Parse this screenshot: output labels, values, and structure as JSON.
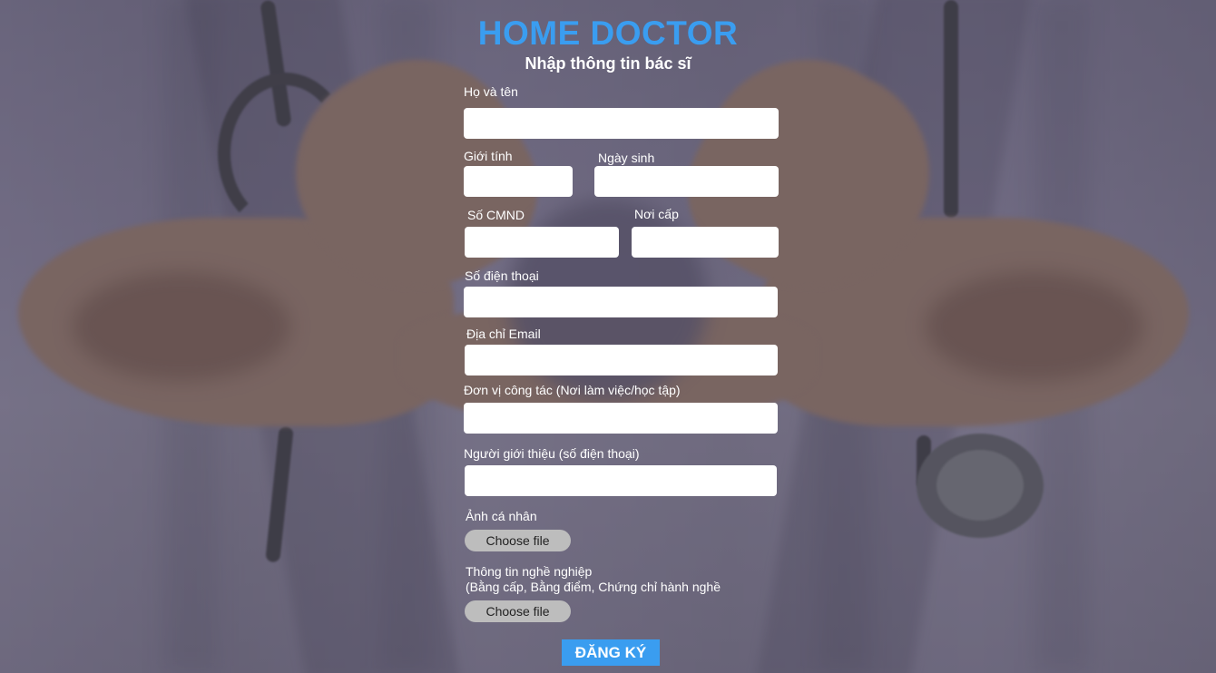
{
  "header": {
    "title": "HOME DOCTOR",
    "subtitle": "Nhập thông tin bác sĩ"
  },
  "form": {
    "full_name_label": "Họ và tên",
    "gender_label": "Giới tính",
    "birthday_label": "Ngày sinh",
    "id_number_label": "Số CMND",
    "issue_place_label": "Nơi cấp",
    "phone_label": "Số điện thoại",
    "email_label": "Địa chỉ Email",
    "workplace_label": "Đơn vị công tác (Nơi làm việc/học tập)",
    "referrer_label": "Người giới thiệu (số điện thoại)",
    "photo_label": "Ảnh cá nhân",
    "professional_label_line1": "Thông tin nghề nghiệp",
    "professional_label_line2": "(Bằng cấp, Bằng điểm, Chứng chỉ hành nghề",
    "choose_file": "Choose file",
    "submit": "ĐĂNG KÝ"
  },
  "colors": {
    "accent": "#3a9df0",
    "file_button": "#bdbdbd"
  }
}
